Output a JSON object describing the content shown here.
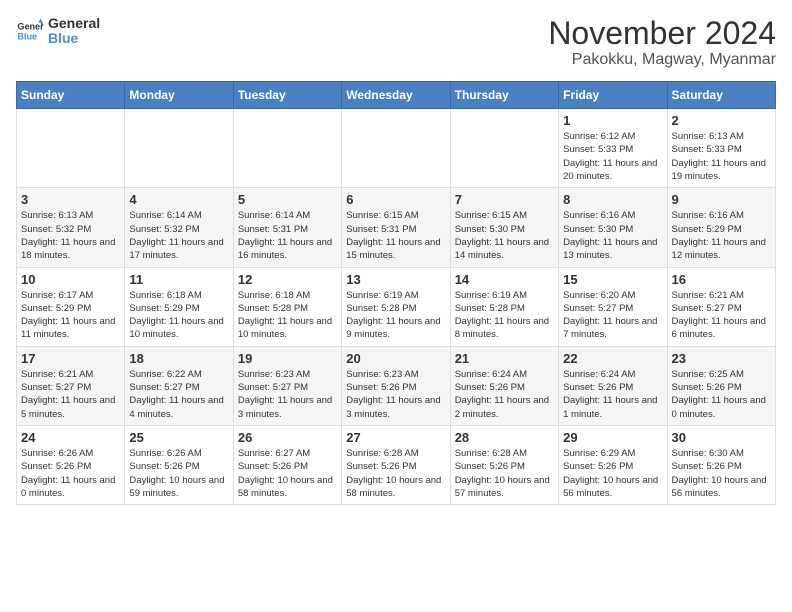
{
  "logo": {
    "line1": "General",
    "line2": "Blue"
  },
  "title": "November 2024",
  "subtitle": "Pakokku, Magway, Myanmar",
  "days_of_week": [
    "Sunday",
    "Monday",
    "Tuesday",
    "Wednesday",
    "Thursday",
    "Friday",
    "Saturday"
  ],
  "weeks": [
    [
      {
        "day": "",
        "text": ""
      },
      {
        "day": "",
        "text": ""
      },
      {
        "day": "",
        "text": ""
      },
      {
        "day": "",
        "text": ""
      },
      {
        "day": "",
        "text": ""
      },
      {
        "day": "1",
        "text": "Sunrise: 6:12 AM\nSunset: 5:33 PM\nDaylight: 11 hours and 20 minutes."
      },
      {
        "day": "2",
        "text": "Sunrise: 6:13 AM\nSunset: 5:33 PM\nDaylight: 11 hours and 19 minutes."
      }
    ],
    [
      {
        "day": "3",
        "text": "Sunrise: 6:13 AM\nSunset: 5:32 PM\nDaylight: 11 hours and 18 minutes."
      },
      {
        "day": "4",
        "text": "Sunrise: 6:14 AM\nSunset: 5:32 PM\nDaylight: 11 hours and 17 minutes."
      },
      {
        "day": "5",
        "text": "Sunrise: 6:14 AM\nSunset: 5:31 PM\nDaylight: 11 hours and 16 minutes."
      },
      {
        "day": "6",
        "text": "Sunrise: 6:15 AM\nSunset: 5:31 PM\nDaylight: 11 hours and 15 minutes."
      },
      {
        "day": "7",
        "text": "Sunrise: 6:15 AM\nSunset: 5:30 PM\nDaylight: 11 hours and 14 minutes."
      },
      {
        "day": "8",
        "text": "Sunrise: 6:16 AM\nSunset: 5:30 PM\nDaylight: 11 hours and 13 minutes."
      },
      {
        "day": "9",
        "text": "Sunrise: 6:16 AM\nSunset: 5:29 PM\nDaylight: 11 hours and 12 minutes."
      }
    ],
    [
      {
        "day": "10",
        "text": "Sunrise: 6:17 AM\nSunset: 5:29 PM\nDaylight: 11 hours and 11 minutes."
      },
      {
        "day": "11",
        "text": "Sunrise: 6:18 AM\nSunset: 5:29 PM\nDaylight: 11 hours and 10 minutes."
      },
      {
        "day": "12",
        "text": "Sunrise: 6:18 AM\nSunset: 5:28 PM\nDaylight: 11 hours and 10 minutes."
      },
      {
        "day": "13",
        "text": "Sunrise: 6:19 AM\nSunset: 5:28 PM\nDaylight: 11 hours and 9 minutes."
      },
      {
        "day": "14",
        "text": "Sunrise: 6:19 AM\nSunset: 5:28 PM\nDaylight: 11 hours and 8 minutes."
      },
      {
        "day": "15",
        "text": "Sunrise: 6:20 AM\nSunset: 5:27 PM\nDaylight: 11 hours and 7 minutes."
      },
      {
        "day": "16",
        "text": "Sunrise: 6:21 AM\nSunset: 5:27 PM\nDaylight: 11 hours and 6 minutes."
      }
    ],
    [
      {
        "day": "17",
        "text": "Sunrise: 6:21 AM\nSunset: 5:27 PM\nDaylight: 11 hours and 5 minutes."
      },
      {
        "day": "18",
        "text": "Sunrise: 6:22 AM\nSunset: 5:27 PM\nDaylight: 11 hours and 4 minutes."
      },
      {
        "day": "19",
        "text": "Sunrise: 6:23 AM\nSunset: 5:27 PM\nDaylight: 11 hours and 3 minutes."
      },
      {
        "day": "20",
        "text": "Sunrise: 6:23 AM\nSunset: 5:26 PM\nDaylight: 11 hours and 3 minutes."
      },
      {
        "day": "21",
        "text": "Sunrise: 6:24 AM\nSunset: 5:26 PM\nDaylight: 11 hours and 2 minutes."
      },
      {
        "day": "22",
        "text": "Sunrise: 6:24 AM\nSunset: 5:26 PM\nDaylight: 11 hours and 1 minute."
      },
      {
        "day": "23",
        "text": "Sunrise: 6:25 AM\nSunset: 5:26 PM\nDaylight: 11 hours and 0 minutes."
      }
    ],
    [
      {
        "day": "24",
        "text": "Sunrise: 6:26 AM\nSunset: 5:26 PM\nDaylight: 11 hours and 0 minutes."
      },
      {
        "day": "25",
        "text": "Sunrise: 6:26 AM\nSunset: 5:26 PM\nDaylight: 10 hours and 59 minutes."
      },
      {
        "day": "26",
        "text": "Sunrise: 6:27 AM\nSunset: 5:26 PM\nDaylight: 10 hours and 58 minutes."
      },
      {
        "day": "27",
        "text": "Sunrise: 6:28 AM\nSunset: 5:26 PM\nDaylight: 10 hours and 58 minutes."
      },
      {
        "day": "28",
        "text": "Sunrise: 6:28 AM\nSunset: 5:26 PM\nDaylight: 10 hours and 57 minutes."
      },
      {
        "day": "29",
        "text": "Sunrise: 6:29 AM\nSunset: 5:26 PM\nDaylight: 10 hours and 56 minutes."
      },
      {
        "day": "30",
        "text": "Sunrise: 6:30 AM\nSunset: 5:26 PM\nDaylight: 10 hours and 56 minutes."
      }
    ]
  ]
}
